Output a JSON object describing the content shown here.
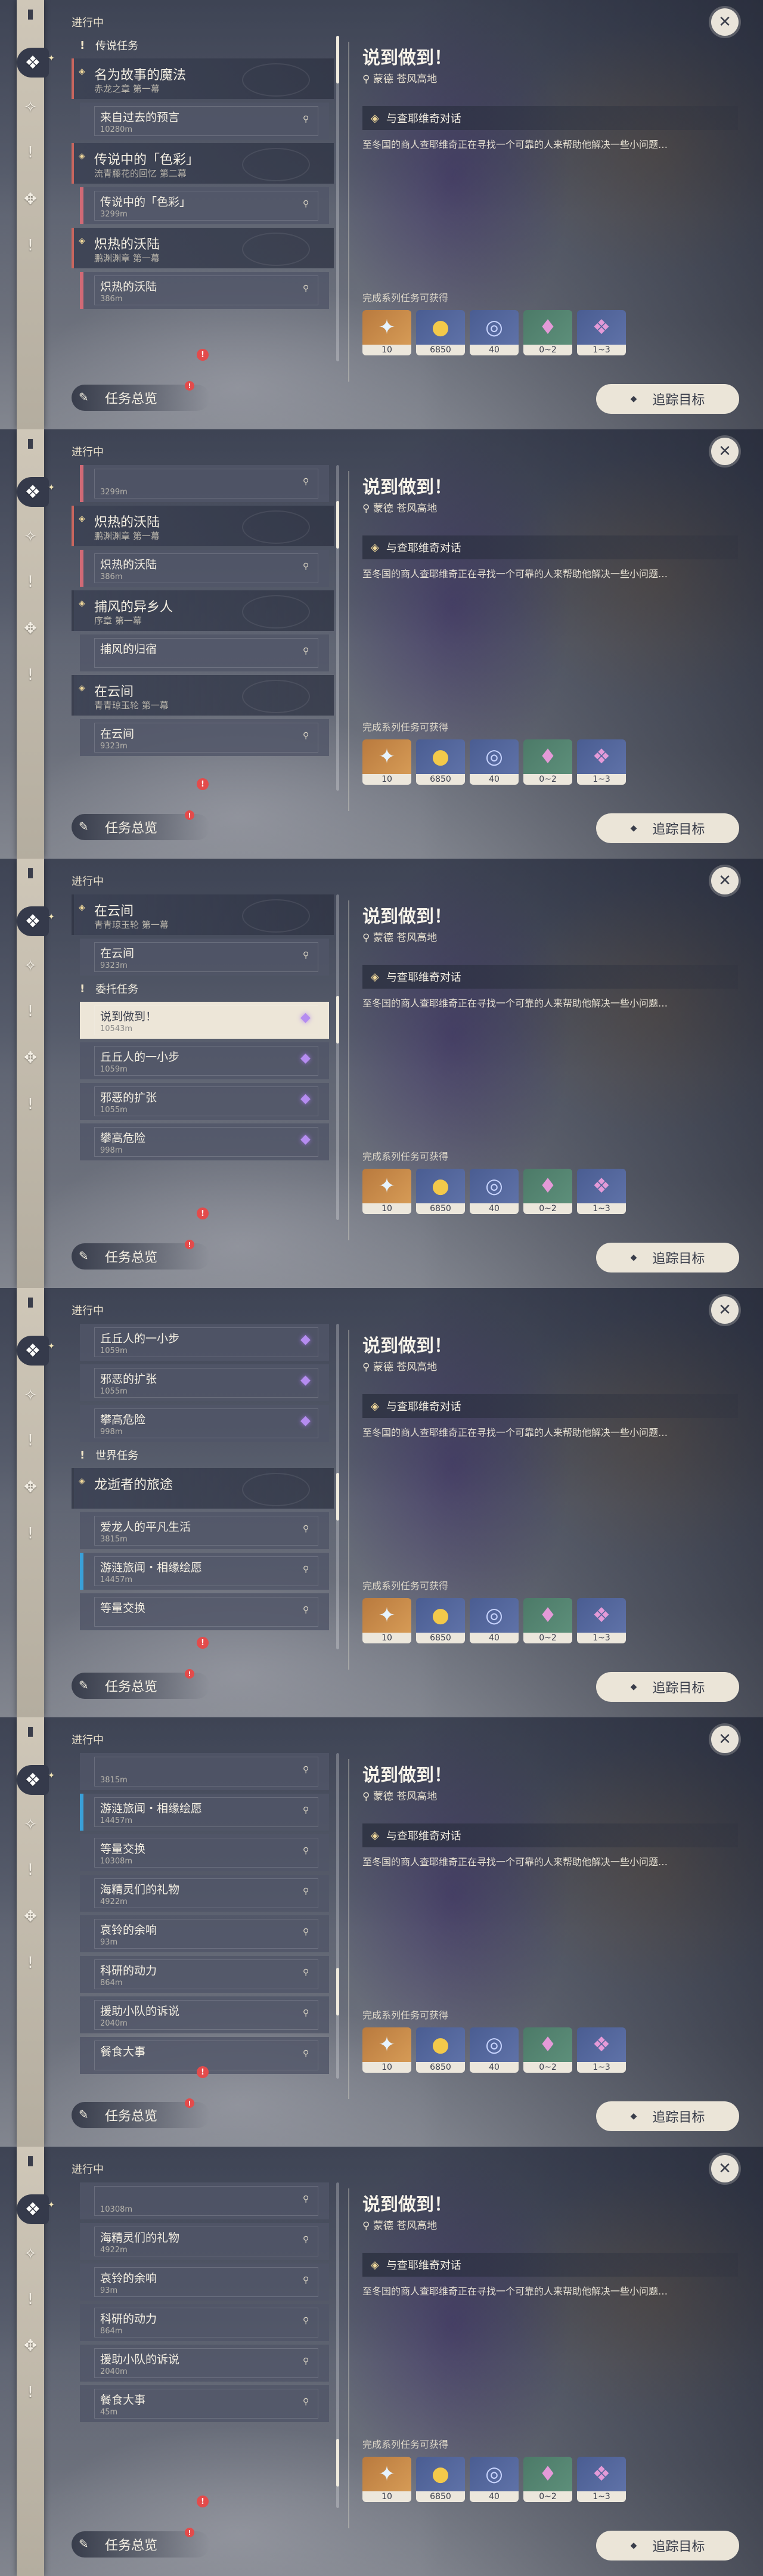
{
  "list_header": "进行中",
  "overview_label": "任务总览",
  "detail": {
    "title": "说到做到！",
    "location": "蒙德 苍风高地",
    "objective": "与查耶维奇对话",
    "description": "至冬国的商人查耶维奇正在寻找一个可靠的人来帮助他解决一些小问题…",
    "rewards_label": "完成系列任务可获得",
    "rewards": [
      {
        "icon": "adventure-exp-icon",
        "count": "10"
      },
      {
        "icon": "mora-icon",
        "count": "6850"
      },
      {
        "icon": "hero-wit-icon",
        "count": "40"
      },
      {
        "icon": "crystal-chunk-icon",
        "count": "0~2"
      },
      {
        "icon": "amethyst-crystal-icon",
        "count": "1~3"
      }
    ],
    "track_label": "追踪目标"
  },
  "panels": [
    {
      "scroll": 0,
      "rows": [
        {
          "kind": "section",
          "label": "传说任务"
        },
        {
          "kind": "chapter",
          "name": "名为故事的魔法",
          "sub": "赤龙之章 第一幕",
          "accent": "red"
        },
        {
          "kind": "quest",
          "name": "来自过去的预言",
          "dist": "10280m"
        },
        {
          "kind": "chapter",
          "name": "传说中的「色彩」",
          "sub": "流青藤花的回忆 第二幕",
          "accent": "red"
        },
        {
          "kind": "quest",
          "name": "传说中的「色彩」",
          "dist": "3299m",
          "accent": "red"
        },
        {
          "kind": "chapter",
          "name": "炽热的沃陆",
          "sub": "鹏渊渊章 第一幕",
          "accent": "red"
        },
        {
          "kind": "quest",
          "name": "炽热的沃陆",
          "dist": "386m",
          "accent": "red"
        }
      ]
    },
    {
      "scroll": 1,
      "rows": [
        {
          "kind": "quest",
          "name": "",
          "dist": "3299m",
          "accent": "red"
        },
        {
          "kind": "chapter",
          "name": "炽热的沃陆",
          "sub": "鹏渊渊章 第一幕",
          "accent": "red"
        },
        {
          "kind": "quest",
          "name": "炽热的沃陆",
          "dist": "386m",
          "accent": "red"
        },
        {
          "kind": "chapter",
          "name": "捕风的异乡人",
          "sub": "序章 第一幕"
        },
        {
          "kind": "quest",
          "name": "捕风的归宿",
          "dist": ""
        },
        {
          "kind": "chapter",
          "name": "在云间",
          "sub": "青青琼玉轮 第一幕"
        },
        {
          "kind": "quest",
          "name": "在云间",
          "dist": "9323m"
        }
      ]
    },
    {
      "scroll": 2,
      "rows": [
        {
          "kind": "chapter",
          "name": "在云间",
          "sub": "青青琼玉轮 第一幕"
        },
        {
          "kind": "quest",
          "name": "在云间",
          "dist": "9323m"
        },
        {
          "kind": "section",
          "label": "委托任务"
        },
        {
          "kind": "quest",
          "name": "说到做到！",
          "dist": "10543m",
          "selected": true,
          "purple": true
        },
        {
          "kind": "quest",
          "name": "丘丘人的一小步",
          "dist": "1059m",
          "purple": true
        },
        {
          "kind": "quest",
          "name": "邪恶的扩张",
          "dist": "1055m",
          "purple": true
        },
        {
          "kind": "quest",
          "name": "攀高危险",
          "dist": "998m",
          "purple": true
        }
      ]
    },
    {
      "scroll": 3,
      "rows": [
        {
          "kind": "quest",
          "name": "丘丘人的一小步",
          "dist": "1059m",
          "purple": true
        },
        {
          "kind": "quest",
          "name": "邪恶的扩张",
          "dist": "1055m",
          "purple": true
        },
        {
          "kind": "quest",
          "name": "攀高危险",
          "dist": "998m",
          "purple": true
        },
        {
          "kind": "section",
          "label": "世界任务"
        },
        {
          "kind": "chapter",
          "name": "龙逝者的旅途",
          "sub": ""
        },
        {
          "kind": "quest",
          "name": "爱龙人的平凡生活",
          "dist": "3815m"
        },
        {
          "kind": "quest",
          "name": "游涟旅闻・相缘绘愿",
          "dist": "14457m",
          "accent": "blue"
        },
        {
          "kind": "quest",
          "name": "等量交换",
          "dist": ""
        }
      ]
    },
    {
      "scroll": 4,
      "rows": [
        {
          "kind": "quest",
          "name": "",
          "dist": "3815m"
        },
        {
          "kind": "quest",
          "name": "游涟旅闻・相缘绘愿",
          "dist": "14457m",
          "accent": "blue"
        },
        {
          "kind": "quest",
          "name": "等量交换",
          "dist": "10308m"
        },
        {
          "kind": "quest",
          "name": "海精灵们的礼物",
          "dist": "4922m"
        },
        {
          "kind": "quest",
          "name": "哀铃的余响",
          "dist": "93m"
        },
        {
          "kind": "quest",
          "name": "科研的动力",
          "dist": "864m"
        },
        {
          "kind": "quest",
          "name": "援助小队的诉说",
          "dist": "2040m"
        },
        {
          "kind": "quest",
          "name": "餐食大事",
          "dist": ""
        }
      ]
    },
    {
      "scroll": 5,
      "rows": [
        {
          "kind": "quest",
          "name": "",
          "dist": "10308m"
        },
        {
          "kind": "quest",
          "name": "海精灵们的礼物",
          "dist": "4922m"
        },
        {
          "kind": "quest",
          "name": "哀铃的余响",
          "dist": "93m"
        },
        {
          "kind": "quest",
          "name": "科研的动力",
          "dist": "864m"
        },
        {
          "kind": "quest",
          "name": "援助小队的诉说",
          "dist": "2040m"
        },
        {
          "kind": "quest",
          "name": "餐食大事",
          "dist": "45m"
        }
      ]
    }
  ]
}
